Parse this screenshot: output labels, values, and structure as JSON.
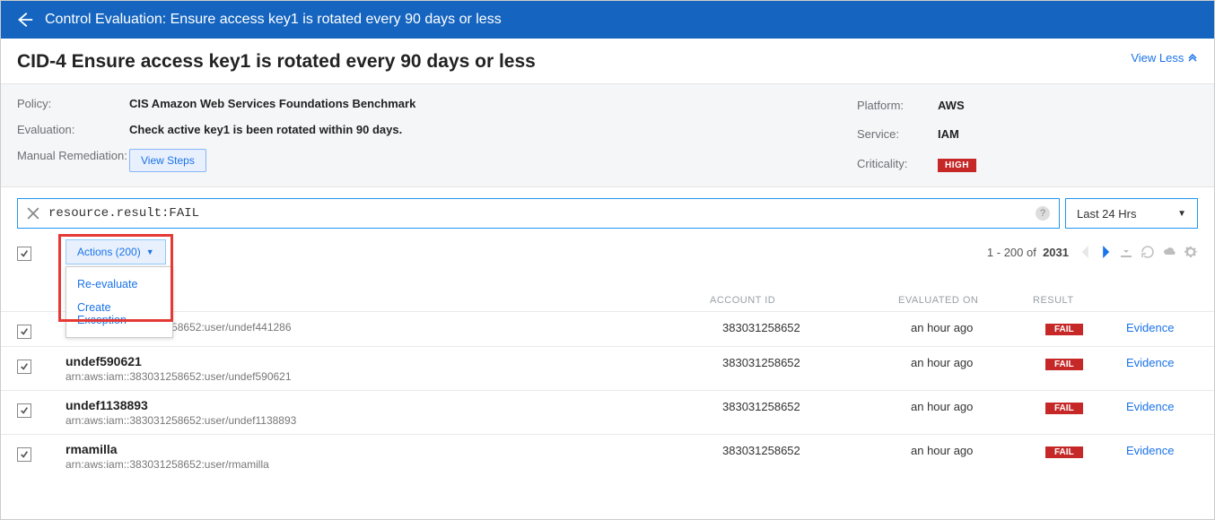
{
  "topbar": {
    "title": "Control Evaluation: Ensure access key1 is rotated every 90 days or less"
  },
  "page": {
    "title": "CID-4 Ensure access key1 is rotated every 90 days or less",
    "view_less": "View Less"
  },
  "meta": {
    "policy_label": "Policy:",
    "policy_value": "CIS Amazon Web Services Foundations Benchmark",
    "evaluation_label": "Evaluation:",
    "evaluation_value": "Check active key1 is been rotated within 90 days.",
    "remediation_label": "Manual Remediation:",
    "view_steps": "View Steps",
    "platform_label": "Platform:",
    "platform_value": "AWS",
    "service_label": "Service:",
    "service_value": "IAM",
    "criticality_label": "Criticality:",
    "criticality_value": "HIGH"
  },
  "search": {
    "value": "resource.result:FAIL"
  },
  "time": {
    "label": "Last 24 Hrs"
  },
  "actions": {
    "label": "Actions (200)",
    "items": [
      "Re-evaluate",
      "Create Exception"
    ]
  },
  "pagination": {
    "range": "1 - 200 of",
    "total": "2031"
  },
  "columns": {
    "account": "ACCOUNT ID",
    "evaluated": "EVALUATED ON",
    "result": "RESULT"
  },
  "evidence_label": "Evidence",
  "fail_label": "FAIL",
  "rows": [
    {
      "name": "",
      "arn": "arn:aws:iam::383031258652:user/undef441286",
      "account": "383031258652",
      "evaluated": "an hour ago"
    },
    {
      "name": "undef590621",
      "arn": "arn:aws:iam::383031258652:user/undef590621",
      "account": "383031258652",
      "evaluated": "an hour ago"
    },
    {
      "name": "undef1138893",
      "arn": "arn:aws:iam::383031258652:user/undef1138893",
      "account": "383031258652",
      "evaluated": "an hour ago"
    },
    {
      "name": "rmamilla",
      "arn": "arn:aws:iam::383031258652:user/rmamilla",
      "account": "383031258652",
      "evaluated": "an hour ago"
    }
  ]
}
